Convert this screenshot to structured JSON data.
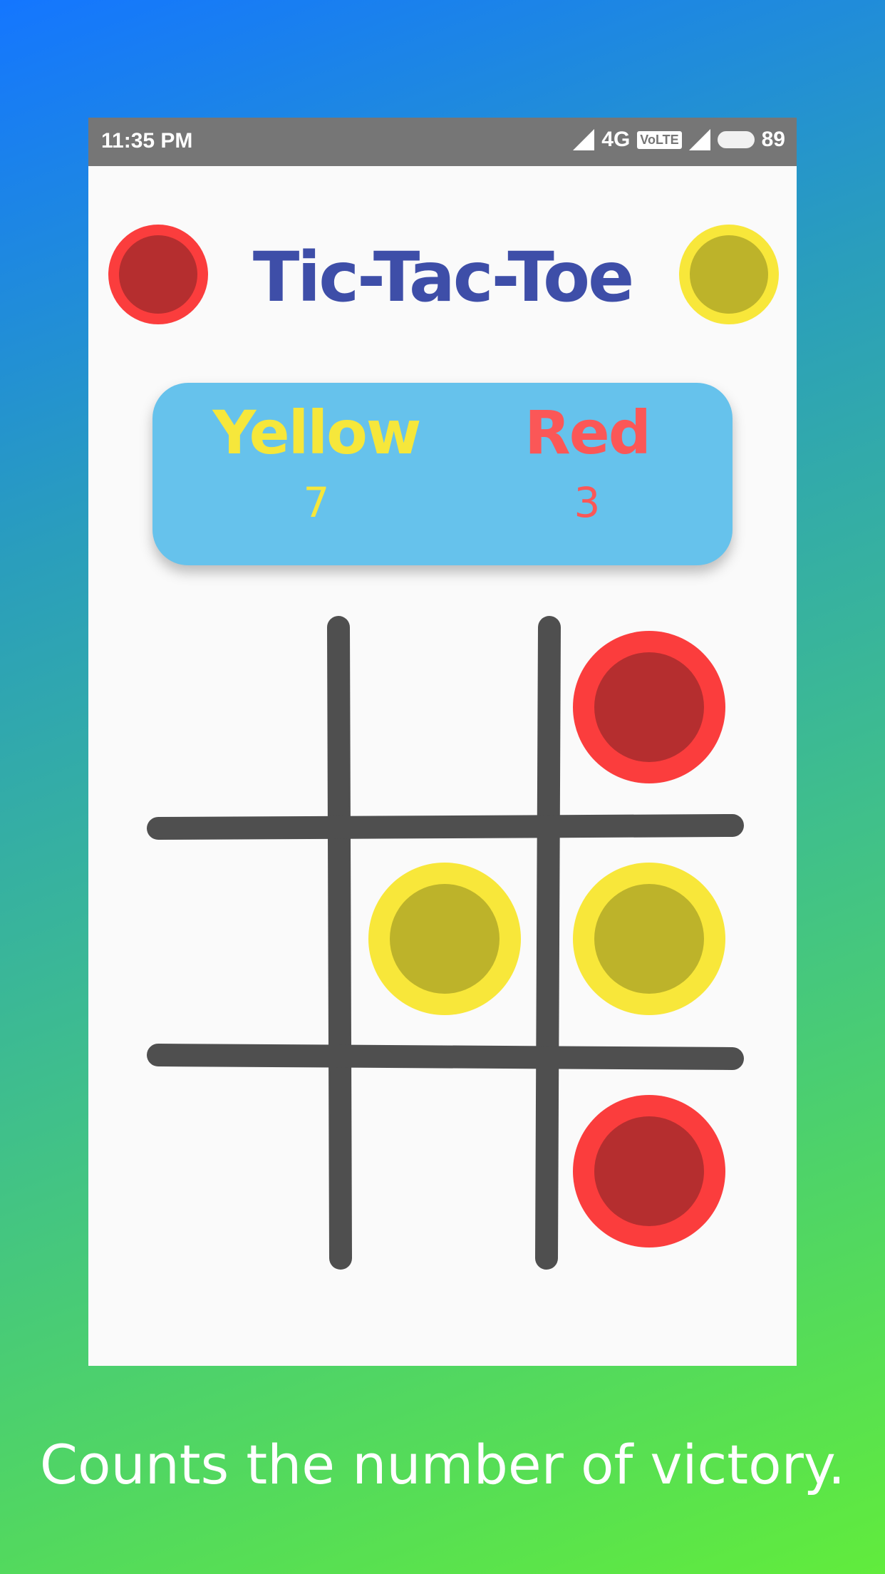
{
  "status_bar": {
    "time": "11:35 PM",
    "network": "4G",
    "volte": "VoLTE",
    "battery": "89"
  },
  "title": "Tic-Tac-Toe",
  "scoreboard": {
    "yellow_label": "Yellow",
    "yellow_score": "7",
    "red_label": "Red",
    "red_score": "3"
  },
  "board": {
    "cells": [
      "",
      "",
      "red",
      "",
      "yellow",
      "yellow",
      "",
      "",
      "red"
    ]
  },
  "caption": "Counts the number of victory.",
  "colors": {
    "title": "#3e4ea8",
    "red_outer": "#fb3d3d",
    "red_inner": "#b52e2f",
    "yellow_outer": "#f8e73a",
    "yellow_inner": "#bdb32a",
    "score_card": "#66c2ec",
    "grid_lines": "#4f4f4f"
  }
}
